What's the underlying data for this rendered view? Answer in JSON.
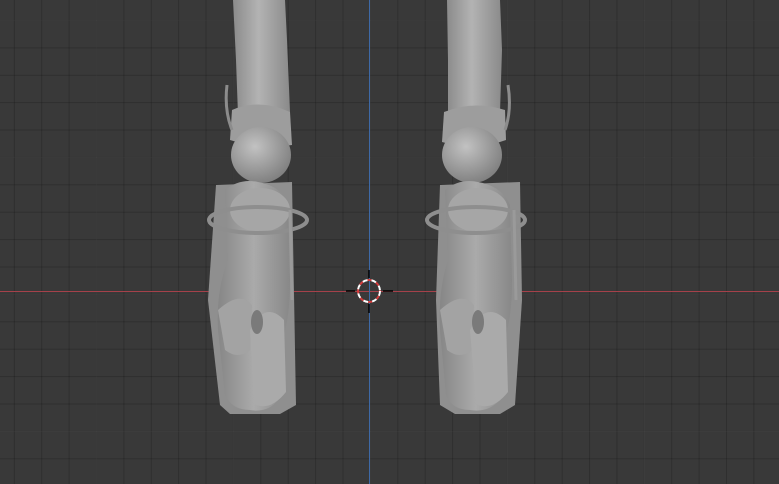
{
  "viewport": {
    "background_color": "#393939",
    "x_axis_color": "#a5414a",
    "y_axis_color": "#3e69a6",
    "mesh_color": "#9a9a9a"
  },
  "objects": {
    "left_foot": "mesh-object",
    "right_foot": "mesh-object",
    "cursor": "3d-cursor-icon"
  }
}
